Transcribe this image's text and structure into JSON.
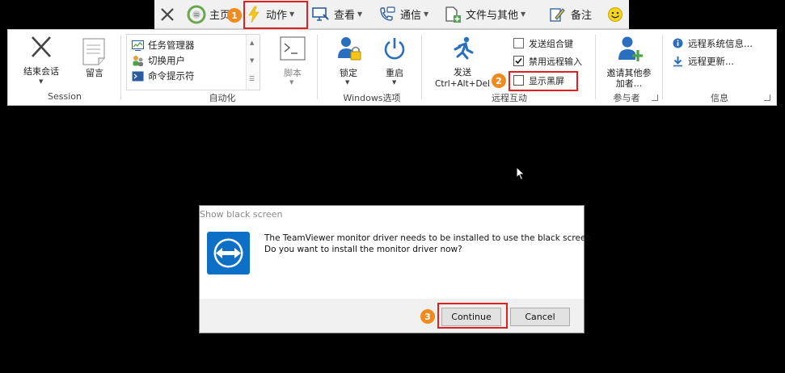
{
  "topbar": {
    "home": "主页",
    "actions": "动作",
    "view": "查看",
    "communicate": "通信",
    "files": "文件与其他",
    "notes": "备注"
  },
  "ribbon": {
    "session": {
      "end_session": "结束会话",
      "leave_message": "留言",
      "group_label": "Session"
    },
    "automation": {
      "items": [
        "任务管理器",
        "切换用户",
        "命令提示符"
      ],
      "script": "脚本",
      "group_label": "自动化"
    },
    "windows": {
      "lock": "锁定",
      "reboot": "重启",
      "group_label": "Windows选项"
    },
    "remote": {
      "send": "发送",
      "send_keys": "Ctrl+Alt+Del",
      "send_combo": "发送组合键",
      "disable_input": "禁用远程输入",
      "show_black_screen": "显示黑屏",
      "group_label": "远程互动"
    },
    "participants": {
      "invite_line1": "邀请其他参",
      "invite_line2": "加者...",
      "group_label": "参与者"
    },
    "info": {
      "remote_system_info": "远程系统信息...",
      "remote_update": "远程更新...",
      "group_label": "信息"
    }
  },
  "dialog": {
    "title": "Show black screen",
    "line1": "The TeamViewer monitor driver needs to be installed to use the black screen.",
    "line2": "Do you want to install the monitor driver now?",
    "continue": "Continue",
    "cancel": "Cancel"
  },
  "badges": {
    "one": "1",
    "two": "2",
    "three": "3"
  },
  "colors": {
    "highlight": "#e0201e",
    "badge": "#f28b1e",
    "teamviewer_blue": "#0e6fc7"
  }
}
